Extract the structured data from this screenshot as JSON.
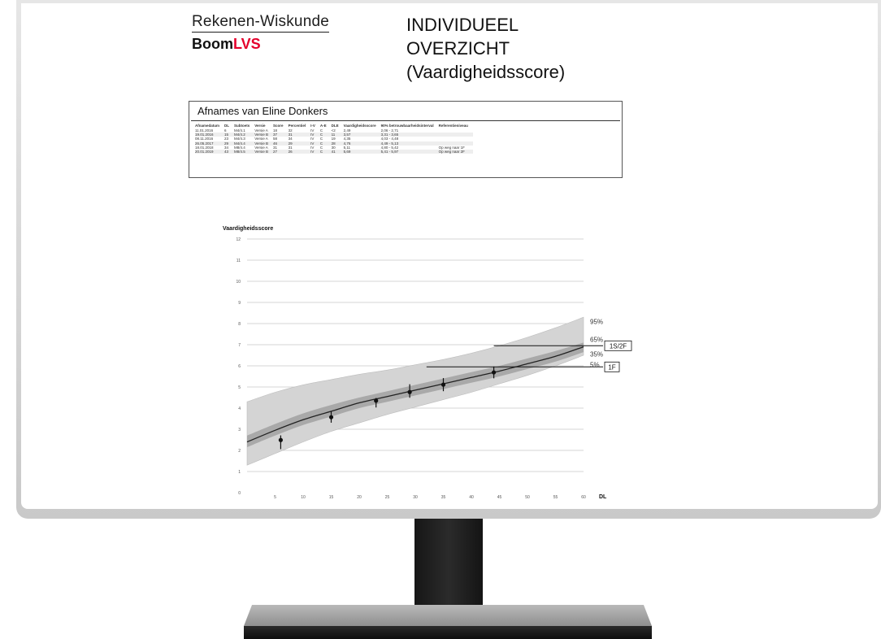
{
  "header": {
    "subject": "Rekenen-Wiskunde",
    "publisher_prefix": "Boom",
    "publisher_suffix": "LVS",
    "title_lines": [
      "INDIVIDUEEL",
      "OVERZICHT",
      "(Vaardigheidsscore)"
    ]
  },
  "table": {
    "title": "Afnames van Eline Donkers",
    "columns": [
      "Afnamedatum",
      "DL",
      "Subtoets",
      "Versie",
      "Score",
      "Percentiel",
      "I-V",
      "A-E",
      "DLE",
      "Vaardigheidsscore",
      "90% betrouwbaarheidsinterval",
      "Referentieniveau"
    ],
    "rows": [
      [
        "11.01.2016",
        "6",
        "M4/4.1",
        "Versie A",
        "18",
        "32",
        "IV",
        "C",
        "<2",
        "2,49",
        "2,06 - 2,71",
        ""
      ],
      [
        "19.01.2016",
        "15",
        "M4/4.2",
        "Versie B",
        "37",
        "31",
        "IV",
        "C",
        "11",
        "3,57",
        "3,31 - 3,65",
        ""
      ],
      [
        "08.11.2016",
        "23",
        "M4/4.3",
        "Versie A",
        "58",
        "34",
        "IV",
        "C",
        "19",
        "4,35",
        "4,03 - 4,48",
        ""
      ],
      [
        "26.05.2017",
        "29",
        "M4/4.4",
        "Versie B",
        "46",
        "29",
        "IV",
        "C",
        "28",
        "4,76",
        "4,49 - 5,13",
        ""
      ],
      [
        "18.01.2018",
        "34",
        "M8/4.4",
        "Versie A",
        "31",
        "31",
        "IV",
        "C",
        "30",
        "5,11",
        "4,80 - 5,42",
        "Op weg naar 1F"
      ],
      [
        "20.01.2019",
        "43",
        "M8/4.5",
        "Versie B",
        "27",
        "26",
        "IV",
        "C",
        "41",
        "5,69",
        "5,41 - 5,97",
        "Op weg naar 2F"
      ]
    ]
  },
  "chart_data": {
    "type": "line",
    "title": "Vaardigheidsscore",
    "xlabel": "DL",
    "ylabel": "",
    "xlim": [
      0,
      60
    ],
    "ylim": [
      0,
      12
    ],
    "xticks": [
      0,
      5,
      10,
      15,
      20,
      25,
      30,
      35,
      40,
      45,
      50,
      55,
      60
    ],
    "yticks": [
      0,
      1,
      2,
      3,
      4,
      5,
      6,
      7,
      8,
      9,
      10,
      11,
      12
    ],
    "band_labels": [
      "95%",
      "65%",
      "35%",
      "5%"
    ],
    "x": [
      0,
      5,
      10,
      15,
      20,
      25,
      30,
      35,
      40,
      45,
      50,
      55,
      60
    ],
    "series": [
      {
        "values": [
          2.4,
          2.95,
          3.45,
          3.85,
          4.25,
          4.55,
          4.85,
          5.15,
          5.45,
          5.75,
          6.1,
          6.45,
          6.9
        ]
      }
    ],
    "band_outer": {
      "upper": [
        4.3,
        4.75,
        5.1,
        5.35,
        5.6,
        5.8,
        6.05,
        6.3,
        6.6,
        6.95,
        7.35,
        7.8,
        8.3
      ],
      "lower": [
        1.3,
        1.85,
        2.4,
        2.9,
        3.3,
        3.7,
        4.05,
        4.4,
        4.75,
        5.15,
        5.55,
        6.0,
        6.5
      ]
    },
    "band_inner": {
      "upper": [
        2.7,
        3.25,
        3.75,
        4.15,
        4.5,
        4.8,
        5.1,
        5.4,
        5.7,
        6.0,
        6.35,
        6.7,
        7.1
      ],
      "lower": [
        2.15,
        2.7,
        3.2,
        3.6,
        4.0,
        4.3,
        4.6,
        4.9,
        5.2,
        5.5,
        5.85,
        6.2,
        6.65
      ]
    },
    "points": [
      {
        "x": 6,
        "y": 2.49,
        "lo": 2.06,
        "hi": 2.71
      },
      {
        "x": 15,
        "y": 3.57,
        "lo": 3.31,
        "hi": 3.85
      },
      {
        "x": 23,
        "y": 4.35,
        "lo": 4.03,
        "hi": 4.48
      },
      {
        "x": 29,
        "y": 4.76,
        "lo": 4.49,
        "hi": 5.13
      },
      {
        "x": 35,
        "y": 5.11,
        "lo": 4.8,
        "hi": 5.42
      },
      {
        "x": 44,
        "y": 5.69,
        "lo": 5.41,
        "hi": 5.97
      }
    ],
    "reference_levels": [
      {
        "label": "1S/2F",
        "y": 6.95,
        "x_start": 44
      },
      {
        "label": "1F",
        "y": 5.95,
        "x_start": 32
      }
    ]
  }
}
